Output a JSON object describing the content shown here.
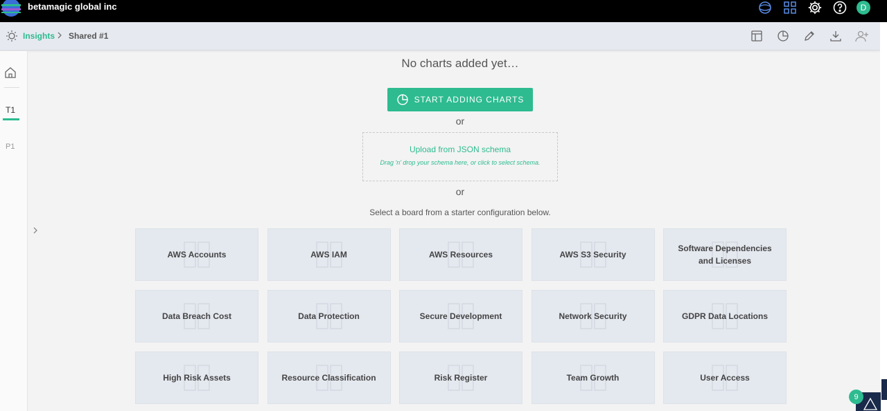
{
  "topbar": {
    "org_name": "betamagic global inc",
    "avatar_initial": "D"
  },
  "breadcrumb": {
    "section": "Insights",
    "current": "Shared #1"
  },
  "rail": {
    "tabs": [
      {
        "label": "T1",
        "active": true
      },
      {
        "label": "P1",
        "active": false
      }
    ]
  },
  "main": {
    "empty_message": "No charts added yet…",
    "start_button": "START ADDING CHARTS",
    "or_1": "or",
    "upload_title": "Upload from JSON schema",
    "upload_subtitle": "Drag 'n' drop your schema here, or click to select schema.",
    "or_2": "or",
    "select_message": "Select a board from a starter configuration below."
  },
  "starter_boards": [
    "AWS Accounts",
    "AWS IAM",
    "AWS Resources",
    "AWS S3 Security",
    "Software Dependencies and Licenses",
    "Data Breach Cost",
    "Data Protection",
    "Secure Development",
    "Network Security",
    "GDPR Data Locations",
    "High Risk Assets",
    "Resource Classification",
    "Risk Register",
    "Team Growth",
    "User Access"
  ],
  "chat": {
    "badge_count": "9"
  },
  "colors": {
    "accent": "#2dbb8f",
    "topbar": "#000000",
    "subheader": "#e6e9f0",
    "card": "#e4e8ef"
  }
}
